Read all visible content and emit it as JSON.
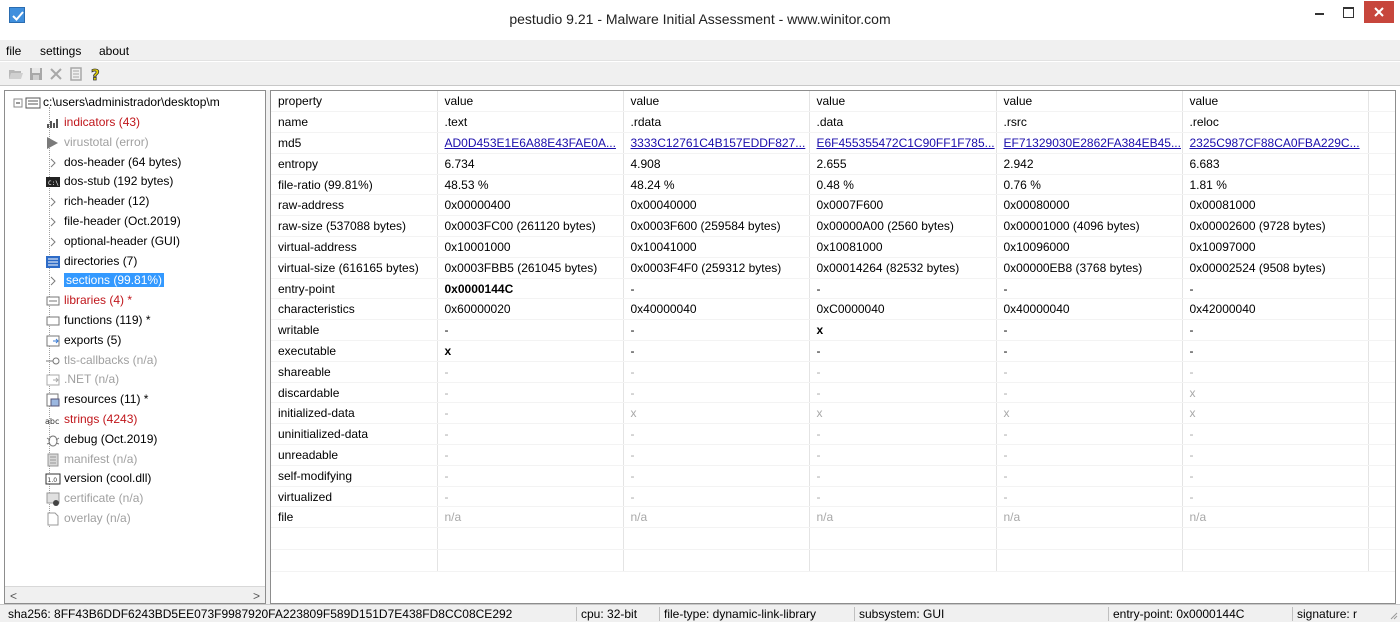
{
  "window": {
    "title": "pestudio 9.21 - Malware Initial Assessment - www.winitor.com",
    "controls": [
      "minimize",
      "maximize",
      "close"
    ]
  },
  "menu": [
    "file",
    "settings",
    "about"
  ],
  "toolbar": {
    "icons": [
      "open-folder-icon",
      "save-icon",
      "delete-icon",
      "document-icon",
      "help-icon"
    ]
  },
  "tree": {
    "root": "c:\\users\\administrador\\desktop\\m",
    "items": [
      {
        "label": "indicators (43)",
        "style": "red",
        "icon": "chart-icon"
      },
      {
        "label": "virustotal (error)",
        "style": "gray",
        "icon": "virustotal-icon"
      },
      {
        "label": "dos-header (64 bytes)",
        "style": "normal",
        "icon": "expand-arrow-icon"
      },
      {
        "label": "dos-stub (192 bytes)",
        "style": "normal",
        "icon": "console-icon"
      },
      {
        "label": "rich-header (12)",
        "style": "normal",
        "icon": "expand-arrow-icon"
      },
      {
        "label": "file-header (Oct.2019)",
        "style": "normal",
        "icon": "expand-arrow-icon"
      },
      {
        "label": "optional-header (GUI)",
        "style": "normal",
        "icon": "expand-arrow-icon"
      },
      {
        "label": "directories (7)",
        "style": "normal",
        "icon": "directories-icon"
      },
      {
        "label": "sections (99.81%)",
        "style": "selected",
        "icon": "expand-arrow-icon"
      },
      {
        "label": "libraries (4) *",
        "style": "red",
        "icon": "library-icon"
      },
      {
        "label": "functions (119) *",
        "style": "normal",
        "icon": "function-icon"
      },
      {
        "label": "exports (5)",
        "style": "normal",
        "icon": "export-icon"
      },
      {
        "label": "tls-callbacks (n/a)",
        "style": "gray",
        "icon": "callback-icon"
      },
      {
        "label": ".NET (n/a)",
        "style": "gray",
        "icon": "dotnet-icon"
      },
      {
        "label": "resources (11) *",
        "style": "normal",
        "icon": "resources-icon"
      },
      {
        "label": "strings (4243)",
        "style": "red",
        "icon": "abc-icon"
      },
      {
        "label": "debug (Oct.2019)",
        "style": "normal",
        "icon": "bug-icon"
      },
      {
        "label": "manifest (n/a)",
        "style": "gray",
        "icon": "manifest-icon"
      },
      {
        "label": "version (cool.dll)",
        "style": "normal",
        "icon": "version-icon"
      },
      {
        "label": "certificate (n/a)",
        "style": "gray",
        "icon": "certificate-icon"
      },
      {
        "label": "overlay (n/a)",
        "style": "gray",
        "icon": "overlay-icon"
      }
    ]
  },
  "grid": {
    "headers": [
      "property",
      "value",
      "value",
      "value",
      "value",
      "value"
    ],
    "rows": [
      {
        "cells": [
          "name",
          ".text",
          ".rdata",
          ".data",
          ".rsrc",
          ".reloc"
        ],
        "style": "normal"
      },
      {
        "cells": [
          "md5",
          "AD0D453E1E6A88E43FAE0A...",
          "3333C12761C4B157EDDF827...",
          "E6F455355472C1C90FF1F785...",
          "EF71329030E2862FA384EB45...",
          "2325C987CF88CA0FBA229C..."
        ],
        "style": "link"
      },
      {
        "cells": [
          "entropy",
          "6.734",
          "4.908",
          "2.655",
          "2.942",
          "6.683"
        ],
        "style": "normal"
      },
      {
        "cells": [
          "file-ratio (99.81%)",
          "48.53 %",
          "48.24 %",
          "0.48 %",
          "0.76 %",
          "1.81 %"
        ],
        "style": "normal"
      },
      {
        "cells": [
          "raw-address",
          "0x00000400",
          "0x00040000",
          "0x0007F600",
          "0x00080000",
          "0x00081000"
        ],
        "style": "normal"
      },
      {
        "cells": [
          "raw-size (537088 bytes)",
          "0x0003FC00 (261120 bytes)",
          "0x0003F600 (259584 bytes)",
          "0x00000A00 (2560 bytes)",
          "0x00001000 (4096 bytes)",
          "0x00002600 (9728 bytes)"
        ],
        "style": "normal"
      },
      {
        "cells": [
          "virtual-address",
          "0x10001000",
          "0x10041000",
          "0x10081000",
          "0x10096000",
          "0x10097000"
        ],
        "style": "normal"
      },
      {
        "cells": [
          "virtual-size (616165 bytes)",
          "0x0003FBB5 (261045 bytes)",
          "0x0003F4F0 (259312 bytes)",
          "0x00014264 (82532 bytes)",
          "0x00000EB8 (3768 bytes)",
          "0x00002524 (9508 bytes)"
        ],
        "style": "normal"
      },
      {
        "cells": [
          "entry-point",
          "0x0000144C",
          "-",
          "-",
          "-",
          "-"
        ],
        "style": "entry"
      },
      {
        "cells": [
          "characteristics",
          "0x60000020",
          "0x40000040",
          "0xC0000040",
          "0x40000040",
          "0x42000040"
        ],
        "style": "normal"
      },
      {
        "cells": [
          "writable",
          "-",
          "-",
          "x",
          "-",
          "-"
        ],
        "style": "mark"
      },
      {
        "cells": [
          "executable",
          "x",
          "-",
          "-",
          "-",
          "-"
        ],
        "style": "mark"
      },
      {
        "cells": [
          "shareable",
          "-",
          "-",
          "-",
          "-",
          "-"
        ],
        "style": "gray"
      },
      {
        "cells": [
          "discardable",
          "-",
          "-",
          "-",
          "-",
          "x"
        ],
        "style": "gray"
      },
      {
        "cells": [
          "initialized-data",
          "-",
          "x",
          "x",
          "x",
          "x"
        ],
        "style": "gray"
      },
      {
        "cells": [
          "uninitialized-data",
          "-",
          "-",
          "-",
          "-",
          "-"
        ],
        "style": "gray"
      },
      {
        "cells": [
          "unreadable",
          "-",
          "-",
          "-",
          "-",
          "-"
        ],
        "style": "gray"
      },
      {
        "cells": [
          "self-modifying",
          "-",
          "-",
          "-",
          "-",
          "-"
        ],
        "style": "gray"
      },
      {
        "cells": [
          "virtualized",
          "-",
          "-",
          "-",
          "-",
          "-"
        ],
        "style": "gray"
      },
      {
        "cells": [
          "file",
          "n/a",
          "n/a",
          "n/a",
          "n/a",
          "n/a"
        ],
        "style": "gray"
      }
    ]
  },
  "status": {
    "sha256": "sha256: 8FF43B6DDF6243BD5EE073F9987920FA223809F589D151D7E438FD8CC08CE292",
    "cpu": "cpu: 32-bit",
    "file_type": "file-type: dynamic-link-library",
    "subsystem": "subsystem: GUI",
    "entry_point": "entry-point: 0x0000144C",
    "signature": "signature: r"
  },
  "colors": {
    "accent": "#3399ff",
    "indicator_red": "#c0161b",
    "link_blue": "#1a0dab",
    "close_button": "#c7463c"
  }
}
